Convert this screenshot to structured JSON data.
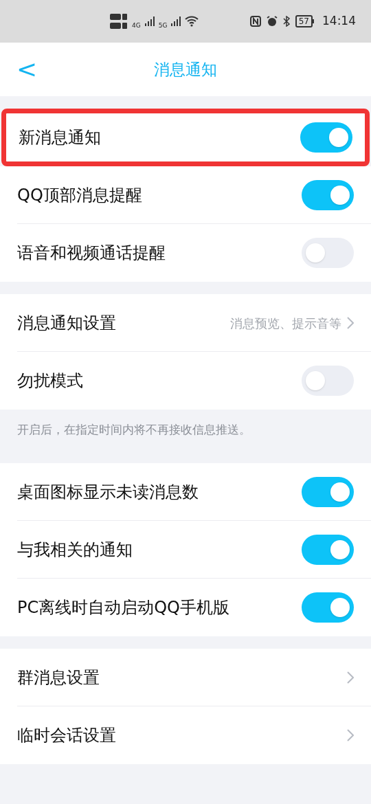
{
  "status_bar": {
    "network_1": "4G",
    "network_2": "5G",
    "battery": "57",
    "time": "14:14"
  },
  "header": {
    "back": "<",
    "title": "消息通知"
  },
  "sections": [
    {
      "rows": [
        {
          "kind": "toggle",
          "label": "新消息通知",
          "on": true,
          "highlighted": true
        },
        {
          "kind": "toggle",
          "label": "QQ顶部消息提醒",
          "on": true,
          "highlighted": false
        },
        {
          "kind": "toggle",
          "label": "语音和视频通话提醒",
          "on": false,
          "highlighted": false
        }
      ]
    },
    {
      "rows": [
        {
          "kind": "link",
          "label": "消息通知设置",
          "value": "消息预览、提示音等",
          "highlighted": false
        },
        {
          "kind": "toggle",
          "label": "勿扰模式",
          "on": false,
          "highlighted": false
        }
      ],
      "note": "开启后，在指定时间内将不再接收信息推送。"
    },
    {
      "rows": [
        {
          "kind": "toggle",
          "label": "桌面图标显示未读消息数",
          "on": true,
          "highlighted": false
        },
        {
          "kind": "toggle",
          "label": "与我相关的通知",
          "on": true,
          "highlighted": false
        },
        {
          "kind": "toggle",
          "label": "PC离线时自动启动QQ手机版",
          "on": true,
          "highlighted": false
        }
      ]
    },
    {
      "rows": [
        {
          "kind": "link",
          "label": "群消息设置",
          "highlighted": false
        },
        {
          "kind": "link",
          "label": "临时会话设置",
          "highlighted": false
        }
      ]
    }
  ]
}
